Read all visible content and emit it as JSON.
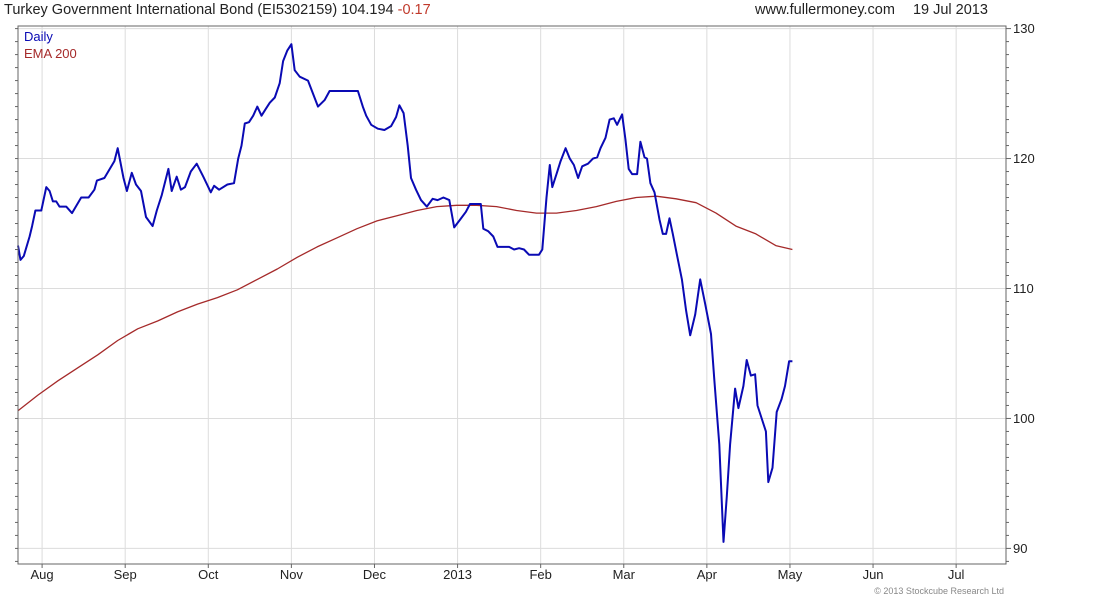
{
  "header": {
    "title": "Turkey Government International Bond (EI5302159)",
    "price": "104.194",
    "change": "-0.17",
    "site": "www.fullermoney.com",
    "date": "19 Jul 2013"
  },
  "footer": {
    "copyright": "© 2013 Stockcube Research Ltd"
  },
  "chart_data": {
    "type": "line",
    "title": "Turkey Government International Bond (EI5302159)",
    "x_tick_labels": [
      "Aug",
      "Sep",
      "Oct",
      "Nov",
      "Dec",
      "2013",
      "Feb",
      "Mar",
      "Apr",
      "May",
      "Jun",
      "Jul"
    ],
    "x_tick_positions": [
      1.0,
      2.0,
      3.0,
      4.0,
      5.0,
      6.0,
      7.0,
      8.0,
      9.0,
      10.0,
      11.0,
      12.0
    ],
    "xlim": [
      0.71,
      12.6
    ],
    "y_ticks": [
      90,
      100,
      110,
      120,
      130
    ],
    "ylim": [
      88.8,
      130.2
    ],
    "grid": true,
    "legend": "top-left",
    "colors": {
      "daily": "#0a0ab4",
      "ema": "#a52a2a"
    },
    "series": [
      {
        "name": "Daily",
        "color": "#0a0ab4",
        "points": [
          [
            0.71,
            113.3
          ],
          [
            0.74,
            112.2
          ],
          [
            0.78,
            112.5
          ],
          [
            0.85,
            114.0
          ],
          [
            0.88,
            114.8
          ],
          [
            0.92,
            116.0
          ],
          [
            0.99,
            116.0
          ],
          [
            1.05,
            117.8
          ],
          [
            1.09,
            117.5
          ],
          [
            1.13,
            116.7
          ],
          [
            1.17,
            116.7
          ],
          [
            1.21,
            116.3
          ],
          [
            1.29,
            116.3
          ],
          [
            1.36,
            115.8
          ],
          [
            1.47,
            117.0
          ],
          [
            1.56,
            117.0
          ],
          [
            1.63,
            117.6
          ],
          [
            1.66,
            118.3
          ],
          [
            1.75,
            118.5
          ],
          [
            1.87,
            119.8
          ],
          [
            1.91,
            120.8
          ],
          [
            1.98,
            118.5
          ],
          [
            2.02,
            117.5
          ],
          [
            2.08,
            118.9
          ],
          [
            2.13,
            118.0
          ],
          [
            2.19,
            117.5
          ],
          [
            2.25,
            115.5
          ],
          [
            2.33,
            114.8
          ],
          [
            2.38,
            116.0
          ],
          [
            2.44,
            117.2
          ],
          [
            2.52,
            119.2
          ],
          [
            2.56,
            117.5
          ],
          [
            2.62,
            118.6
          ],
          [
            2.67,
            117.6
          ],
          [
            2.72,
            117.8
          ],
          [
            2.79,
            119.0
          ],
          [
            2.86,
            119.6
          ],
          [
            2.94,
            118.6
          ],
          [
            3.03,
            117.4
          ],
          [
            3.07,
            117.9
          ],
          [
            3.13,
            117.6
          ],
          [
            3.23,
            118.0
          ],
          [
            3.31,
            118.1
          ],
          [
            3.36,
            120.0
          ],
          [
            3.4,
            121.0
          ],
          [
            3.44,
            122.7
          ],
          [
            3.49,
            122.8
          ],
          [
            3.54,
            123.3
          ],
          [
            3.59,
            124.0
          ],
          [
            3.64,
            123.3
          ],
          [
            3.69,
            123.8
          ],
          [
            3.74,
            124.3
          ],
          [
            3.8,
            124.7
          ],
          [
            3.86,
            125.8
          ],
          [
            3.9,
            127.5
          ],
          [
            3.95,
            128.3
          ],
          [
            4.0,
            128.8
          ],
          [
            4.04,
            126.8
          ],
          [
            4.1,
            126.3
          ],
          [
            4.2,
            126.0
          ],
          [
            4.26,
            125.0
          ],
          [
            4.32,
            124.0
          ],
          [
            4.4,
            124.5
          ],
          [
            4.46,
            125.2
          ],
          [
            4.6,
            125.2
          ],
          [
            4.7,
            125.2
          ],
          [
            4.8,
            125.2
          ],
          [
            4.86,
            124.0
          ],
          [
            4.9,
            123.3
          ],
          [
            4.96,
            122.6
          ],
          [
            5.04,
            122.3
          ],
          [
            5.12,
            122.2
          ],
          [
            5.2,
            122.5
          ],
          [
            5.26,
            123.2
          ],
          [
            5.3,
            124.1
          ],
          [
            5.35,
            123.5
          ],
          [
            5.4,
            121.0
          ],
          [
            5.44,
            118.5
          ],
          [
            5.5,
            117.6
          ],
          [
            5.56,
            116.8
          ],
          [
            5.63,
            116.3
          ],
          [
            5.7,
            116.9
          ],
          [
            5.76,
            116.8
          ],
          [
            5.83,
            117.0
          ],
          [
            5.9,
            116.8
          ],
          [
            5.96,
            114.7
          ],
          [
            6.03,
            115.3
          ],
          [
            6.1,
            115.9
          ],
          [
            6.15,
            116.5
          ],
          [
            6.23,
            116.5
          ],
          [
            6.28,
            116.5
          ],
          [
            6.31,
            114.6
          ],
          [
            6.37,
            114.4
          ],
          [
            6.43,
            114.0
          ],
          [
            6.48,
            113.2
          ],
          [
            6.56,
            113.2
          ],
          [
            6.62,
            113.2
          ],
          [
            6.68,
            113.0
          ],
          [
            6.74,
            113.1
          ],
          [
            6.8,
            113.0
          ],
          [
            6.86,
            112.6
          ],
          [
            6.92,
            112.6
          ],
          [
            6.98,
            112.6
          ],
          [
            7.02,
            113.0
          ],
          [
            7.07,
            117.0
          ],
          [
            7.11,
            119.5
          ],
          [
            7.14,
            117.8
          ],
          [
            7.19,
            118.8
          ],
          [
            7.24,
            119.8
          ],
          [
            7.3,
            120.8
          ],
          [
            7.35,
            120.0
          ],
          [
            7.4,
            119.5
          ],
          [
            7.45,
            118.5
          ],
          [
            7.5,
            119.4
          ],
          [
            7.57,
            119.6
          ],
          [
            7.63,
            120.0
          ],
          [
            7.68,
            120.1
          ],
          [
            7.72,
            120.8
          ],
          [
            7.78,
            121.6
          ],
          [
            7.83,
            123.0
          ],
          [
            7.88,
            123.1
          ],
          [
            7.92,
            122.6
          ],
          [
            7.98,
            123.4
          ],
          [
            8.02,
            121.5
          ],
          [
            8.06,
            119.2
          ],
          [
            8.1,
            118.8
          ],
          [
            8.16,
            118.8
          ],
          [
            8.2,
            121.3
          ],
          [
            8.25,
            120.1
          ],
          [
            8.28,
            120.0
          ],
          [
            8.32,
            118.1
          ],
          [
            8.37,
            117.4
          ],
          [
            8.43,
            115.3
          ],
          [
            8.47,
            114.2
          ],
          [
            8.51,
            114.2
          ],
          [
            8.55,
            115.4
          ],
          [
            8.59,
            114.2
          ],
          [
            8.64,
            112.6
          ],
          [
            8.7,
            110.7
          ],
          [
            8.75,
            108.3
          ],
          [
            8.8,
            106.4
          ],
          [
            8.86,
            108.0
          ],
          [
            8.92,
            110.7
          ],
          [
            8.98,
            108.8
          ],
          [
            9.05,
            106.5
          ],
          [
            9.09,
            103.0
          ],
          [
            9.15,
            98.0
          ],
          [
            9.2,
            90.5
          ],
          [
            9.24,
            94.0
          ],
          [
            9.28,
            98.0
          ],
          [
            9.34,
            102.3
          ],
          [
            9.38,
            100.8
          ],
          [
            9.44,
            102.5
          ],
          [
            9.48,
            104.5
          ],
          [
            9.53,
            103.3
          ],
          [
            9.58,
            103.4
          ],
          [
            9.61,
            101.0
          ],
          [
            9.66,
            100.0
          ],
          [
            9.71,
            99.0
          ],
          [
            9.74,
            95.1
          ],
          [
            9.79,
            96.2
          ],
          [
            9.84,
            100.5
          ],
          [
            9.9,
            101.5
          ],
          [
            9.94,
            102.5
          ],
          [
            9.99,
            104.4
          ],
          [
            10.03,
            104.4
          ]
        ]
      },
      {
        "name": "EMA 200",
        "color": "#a52a2a",
        "points": [
          [
            0.71,
            100.6
          ],
          [
            0.95,
            101.8
          ],
          [
            1.19,
            102.9
          ],
          [
            1.43,
            103.9
          ],
          [
            1.67,
            104.9
          ],
          [
            1.91,
            106.0
          ],
          [
            2.15,
            106.9
          ],
          [
            2.39,
            107.5
          ],
          [
            2.63,
            108.2
          ],
          [
            2.87,
            108.8
          ],
          [
            3.11,
            109.3
          ],
          [
            3.35,
            109.9
          ],
          [
            3.59,
            110.7
          ],
          [
            3.83,
            111.5
          ],
          [
            4.07,
            112.4
          ],
          [
            4.31,
            113.2
          ],
          [
            4.55,
            113.9
          ],
          [
            4.79,
            114.6
          ],
          [
            5.03,
            115.2
          ],
          [
            5.27,
            115.6
          ],
          [
            5.51,
            116.0
          ],
          [
            5.75,
            116.3
          ],
          [
            5.99,
            116.4
          ],
          [
            6.23,
            116.4
          ],
          [
            6.47,
            116.3
          ],
          [
            6.71,
            116.0
          ],
          [
            6.95,
            115.8
          ],
          [
            7.19,
            115.8
          ],
          [
            7.43,
            116.0
          ],
          [
            7.67,
            116.3
          ],
          [
            7.91,
            116.7
          ],
          [
            8.15,
            117.0
          ],
          [
            8.39,
            117.1
          ],
          [
            8.63,
            116.9
          ],
          [
            8.87,
            116.6
          ],
          [
            9.11,
            115.8
          ],
          [
            9.35,
            114.8
          ],
          [
            9.59,
            114.2
          ],
          [
            9.83,
            113.3
          ],
          [
            10.03,
            113.0
          ]
        ]
      }
    ]
  }
}
